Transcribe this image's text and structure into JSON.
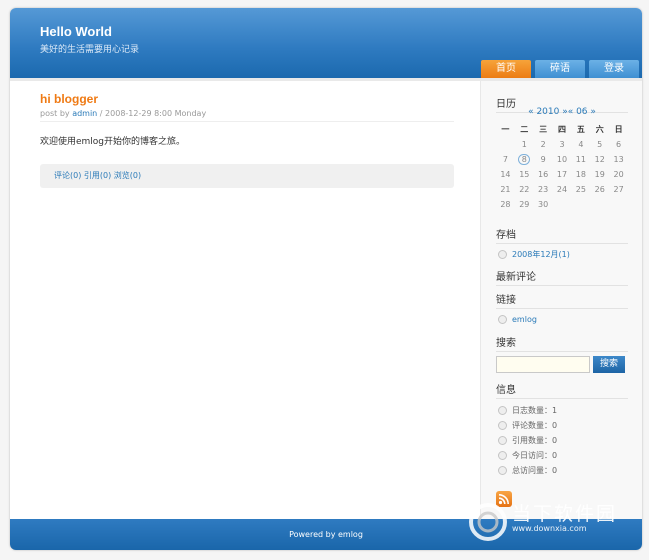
{
  "header": {
    "title": "Hello World",
    "subtitle": "美好的生活需要用心记录",
    "nav": [
      "首页",
      "碎语",
      "登录"
    ]
  },
  "post": {
    "title": "hi blogger",
    "meta_prefix": "post by ",
    "author": "admin",
    "meta_suffix": " / 2008-12-29 8:00 Monday",
    "body": "欢迎使用emlog开始你的博客之旅。",
    "comments": "评论(0)",
    "trackbacks": "引用(0)",
    "views": "浏览(0)"
  },
  "sidebar": {
    "calendar_title": "日历",
    "calendar_nav": "« 2010 »« 06 »",
    "weekdays": [
      "一",
      "二",
      "三",
      "四",
      "五",
      "六",
      "日"
    ],
    "weeks": [
      [
        "",
        "1",
        "2",
        "3",
        "4",
        "5",
        "6"
      ],
      [
        "7",
        "8",
        "9",
        "10",
        "11",
        "12",
        "13"
      ],
      [
        "14",
        "15",
        "16",
        "17",
        "18",
        "19",
        "20"
      ],
      [
        "21",
        "22",
        "23",
        "24",
        "25",
        "26",
        "27"
      ],
      [
        "28",
        "29",
        "30",
        "",
        "",
        "",
        ""
      ]
    ],
    "today": "8",
    "archive_title": "存档",
    "archive_item": "2008年12月(1)",
    "recent_comments_title": "最新评论",
    "links_title": "链接",
    "link_item": "emlog",
    "search_title": "搜索",
    "search_value": "",
    "search_button": "搜索",
    "info_title": "信息",
    "info_items": [
      "日志数量：1",
      "评论数量：0",
      "引用数量：0",
      "今日访问：0",
      "总访问量：0"
    ]
  },
  "footer": {
    "text": "Powered by emlog"
  },
  "watermark": {
    "brand": "当下软件园",
    "url": "www.downxia.com"
  },
  "colors": {
    "header_blue": "#2f7bc1",
    "accent_orange": "#ef7a14",
    "link_blue": "#2a7ab8"
  }
}
